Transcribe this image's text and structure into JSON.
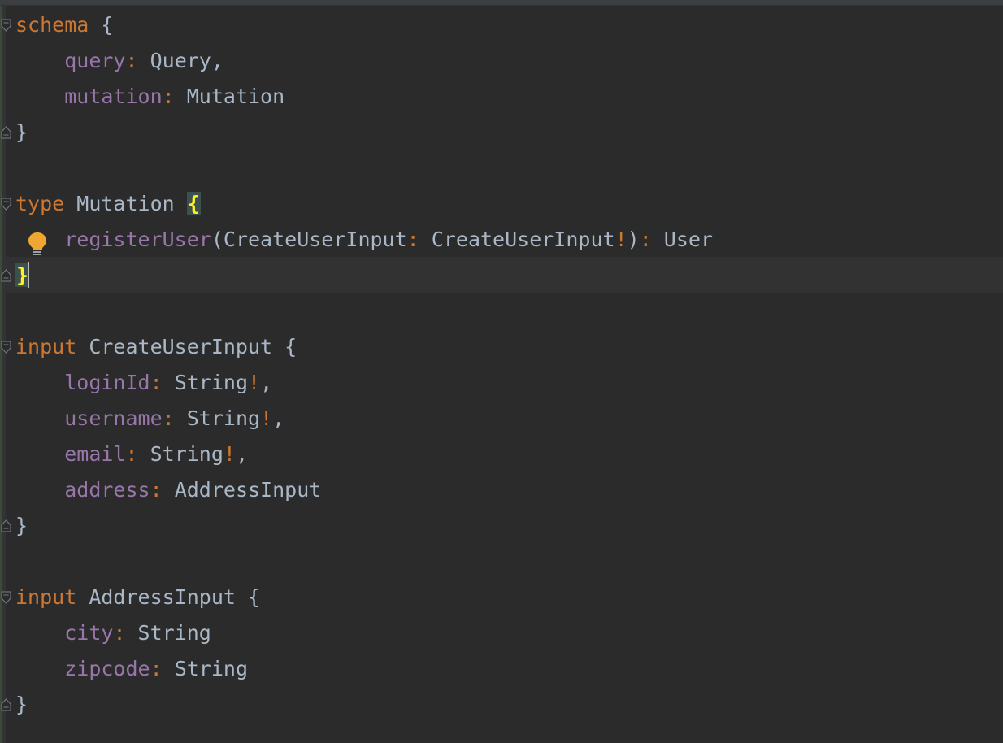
{
  "editor": {
    "lines": [
      {
        "tokens": [
          {
            "t": "schema",
            "c": "kw"
          },
          {
            "t": " ",
            "c": "typ"
          },
          {
            "t": "{",
            "c": "brace"
          }
        ]
      },
      {
        "tokens": [
          {
            "t": "    ",
            "c": "typ"
          },
          {
            "t": "query",
            "c": "fld"
          },
          {
            "t": ":",
            "c": "pun"
          },
          {
            "t": " Query,",
            "c": "typ"
          }
        ]
      },
      {
        "tokens": [
          {
            "t": "    ",
            "c": "typ"
          },
          {
            "t": "mutation",
            "c": "fld"
          },
          {
            "t": ":",
            "c": "pun"
          },
          {
            "t": " Mutation",
            "c": "typ"
          }
        ]
      },
      {
        "tokens": [
          {
            "t": "}",
            "c": "brace"
          }
        ]
      },
      {
        "tokens": []
      },
      {
        "tokens": [
          {
            "t": "type",
            "c": "kw"
          },
          {
            "t": " Mutation ",
            "c": "typ"
          },
          {
            "t": "{",
            "c": "brace-hl"
          }
        ]
      },
      {
        "tokens": [
          {
            "t": "    ",
            "c": "typ"
          },
          {
            "t": "registerUser",
            "c": "fld"
          },
          {
            "t": "(CreateUserInput",
            "c": "typ"
          },
          {
            "t": ":",
            "c": "pun"
          },
          {
            "t": " CreateUserInput",
            "c": "typ"
          },
          {
            "t": "!",
            "c": "pun"
          },
          {
            "t": ")",
            "c": "typ"
          },
          {
            "t": ":",
            "c": "pun"
          },
          {
            "t": " User",
            "c": "typ"
          }
        ]
      },
      {
        "tokens": [
          {
            "t": "}",
            "c": "brace-hl"
          }
        ]
      },
      {
        "tokens": []
      },
      {
        "tokens": [
          {
            "t": "input",
            "c": "kw"
          },
          {
            "t": " CreateUserInput {",
            "c": "typ"
          }
        ]
      },
      {
        "tokens": [
          {
            "t": "    ",
            "c": "typ"
          },
          {
            "t": "loginId",
            "c": "fld"
          },
          {
            "t": ":",
            "c": "pun"
          },
          {
            "t": " String",
            "c": "typ"
          },
          {
            "t": "!",
            "c": "pun"
          },
          {
            "t": ",",
            "c": "typ"
          }
        ]
      },
      {
        "tokens": [
          {
            "t": "    ",
            "c": "typ"
          },
          {
            "t": "username",
            "c": "fld"
          },
          {
            "t": ":",
            "c": "pun"
          },
          {
            "t": " String",
            "c": "typ"
          },
          {
            "t": "!",
            "c": "pun"
          },
          {
            "t": ",",
            "c": "typ"
          }
        ]
      },
      {
        "tokens": [
          {
            "t": "    ",
            "c": "typ"
          },
          {
            "t": "email",
            "c": "fld"
          },
          {
            "t": ":",
            "c": "pun"
          },
          {
            "t": " String",
            "c": "typ"
          },
          {
            "t": "!",
            "c": "pun"
          },
          {
            "t": ",",
            "c": "typ"
          }
        ]
      },
      {
        "tokens": [
          {
            "t": "    ",
            "c": "typ"
          },
          {
            "t": "address",
            "c": "fld"
          },
          {
            "t": ":",
            "c": "pun"
          },
          {
            "t": " AddressInput",
            "c": "typ"
          }
        ]
      },
      {
        "tokens": [
          {
            "t": "}",
            "c": "brace"
          }
        ]
      },
      {
        "tokens": []
      },
      {
        "tokens": [
          {
            "t": "input",
            "c": "kw"
          },
          {
            "t": " AddressInput {",
            "c": "typ"
          }
        ]
      },
      {
        "tokens": [
          {
            "t": "    ",
            "c": "typ"
          },
          {
            "t": "city",
            "c": "fld"
          },
          {
            "t": ":",
            "c": "pun"
          },
          {
            "t": " String",
            "c": "typ"
          }
        ]
      },
      {
        "tokens": [
          {
            "t": "    ",
            "c": "typ"
          },
          {
            "t": "zipcode",
            "c": "fld"
          },
          {
            "t": ":",
            "c": "pun"
          },
          {
            "t": " String",
            "c": "typ"
          }
        ]
      },
      {
        "tokens": [
          {
            "t": "}",
            "c": "brace"
          }
        ]
      }
    ],
    "fold_lines": [
      0,
      3,
      5,
      7,
      9,
      14,
      16,
      19
    ],
    "fold_kinds": [
      "open",
      "close",
      "open",
      "close",
      "open",
      "close",
      "open",
      "close"
    ],
    "current_line": 7,
    "intention_icon": "lightbulb-icon",
    "colors": {
      "background": "#2b2b2b",
      "keyword": "#cc7832",
      "field": "#9876aa",
      "text": "#a9b7c6",
      "brace_match": "#ffef28",
      "lightbulb": "#f0a732"
    }
  }
}
